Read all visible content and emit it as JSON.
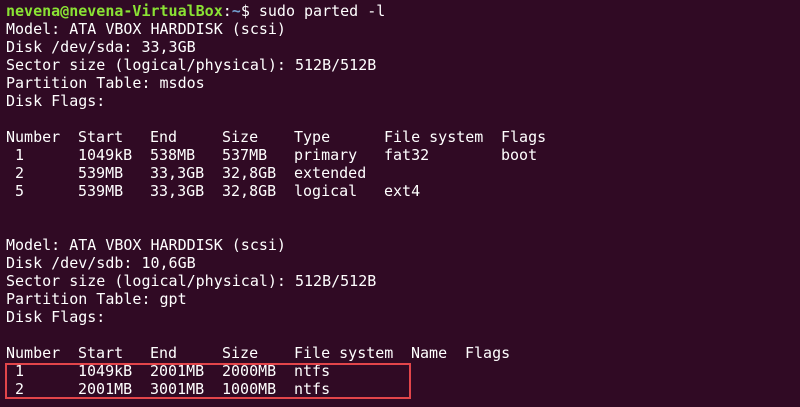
{
  "prompt": {
    "user_host": "nevena@nevena-VirtualBox",
    "separator": ":",
    "path": "~",
    "symbol": "$",
    "command": " sudo parted -l"
  },
  "disk1": {
    "model": "Model: ATA VBOX HARDDISK (scsi)",
    "disk": "Disk /dev/sda: 33,3GB",
    "sector": "Sector size (logical/physical): 512B/512B",
    "table": "Partition Table: msdos",
    "flags": "Disk Flags:",
    "headers": [
      "Number",
      "Start",
      "End",
      "Size",
      "Type",
      "File system",
      "Flags"
    ],
    "rows": [
      [
        " 1",
        "1049kB",
        "538MB",
        "537MB",
        "primary",
        "fat32",
        "boot"
      ],
      [
        " 2",
        "539MB",
        "33,3GB",
        "32,8GB",
        "extended",
        "",
        ""
      ],
      [
        " 5",
        "539MB",
        "33,3GB",
        "32,8GB",
        "logical",
        "ext4",
        ""
      ]
    ]
  },
  "disk2": {
    "model": "Model: ATA VBOX HARDDISK (scsi)",
    "disk": "Disk /dev/sdb: 10,6GB",
    "sector": "Sector size (logical/physical): 512B/512B",
    "table": "Partition Table: gpt",
    "flags": "Disk Flags:",
    "headers": [
      "Number",
      "Start",
      "End",
      "Size",
      "File system",
      "Name",
      "Flags"
    ],
    "rows": [
      [
        " 1",
        "1049kB",
        "2001MB",
        "2000MB",
        "ntfs",
        "",
        ""
      ],
      [
        " 2",
        "2001MB",
        "3001MB",
        "1000MB",
        "ntfs",
        "",
        ""
      ]
    ]
  },
  "colors": {
    "background": "#300a24",
    "user_host": "#8ae234",
    "path": "#729fcf",
    "highlight_border": "#e2454a"
  }
}
